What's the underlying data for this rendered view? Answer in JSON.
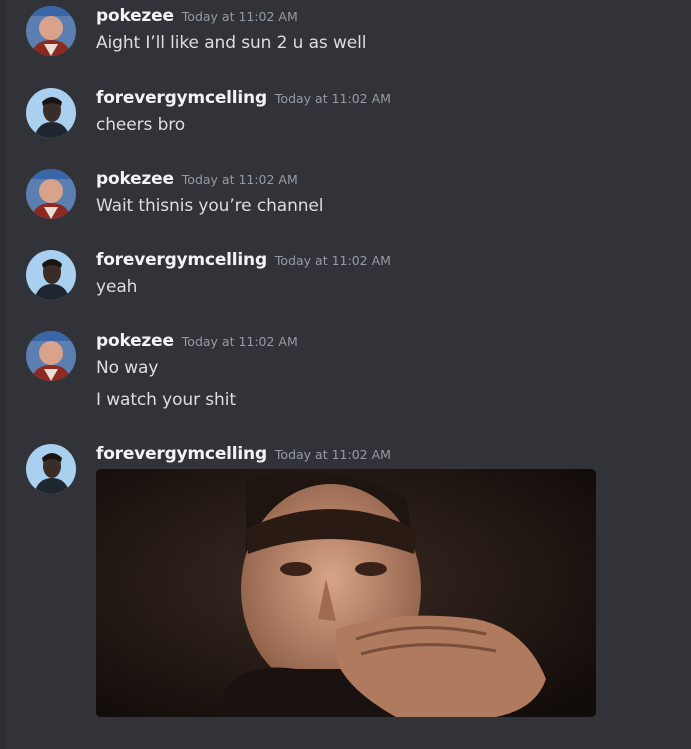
{
  "messages": [
    {
      "username": "pokezee",
      "timestamp": "Today at 11:02 AM",
      "avatar": "pokezee-avatar",
      "lines": [
        "Aight I’ll like and sun 2 u as well"
      ]
    },
    {
      "username": "forevergymcelling",
      "timestamp": "Today at 11:02 AM",
      "avatar": "forevergymcelling-avatar",
      "lines": [
        "cheers bro"
      ]
    },
    {
      "username": "pokezee",
      "timestamp": "Today at 11:02 AM",
      "avatar": "pokezee-avatar",
      "lines": [
        "Wait thisnis you’re channel"
      ]
    },
    {
      "username": "forevergymcelling",
      "timestamp": "Today at 11:02 AM",
      "avatar": "forevergymcelling-avatar",
      "lines": [
        "yeah"
      ]
    },
    {
      "username": "pokezee",
      "timestamp": "Today at 11:02 AM",
      "avatar": "pokezee-avatar",
      "lines": [
        "No way",
        "I watch your shit"
      ]
    },
    {
      "username": "forevergymcelling",
      "timestamp": "Today at 11:02 AM",
      "avatar": "forevergymcelling-avatar",
      "attachment": "gif-image"
    }
  ],
  "colors": {
    "background": "#323339",
    "username": "#f2f3f5",
    "timestamp": "#949ba4",
    "message_text": "#dbdee1"
  }
}
